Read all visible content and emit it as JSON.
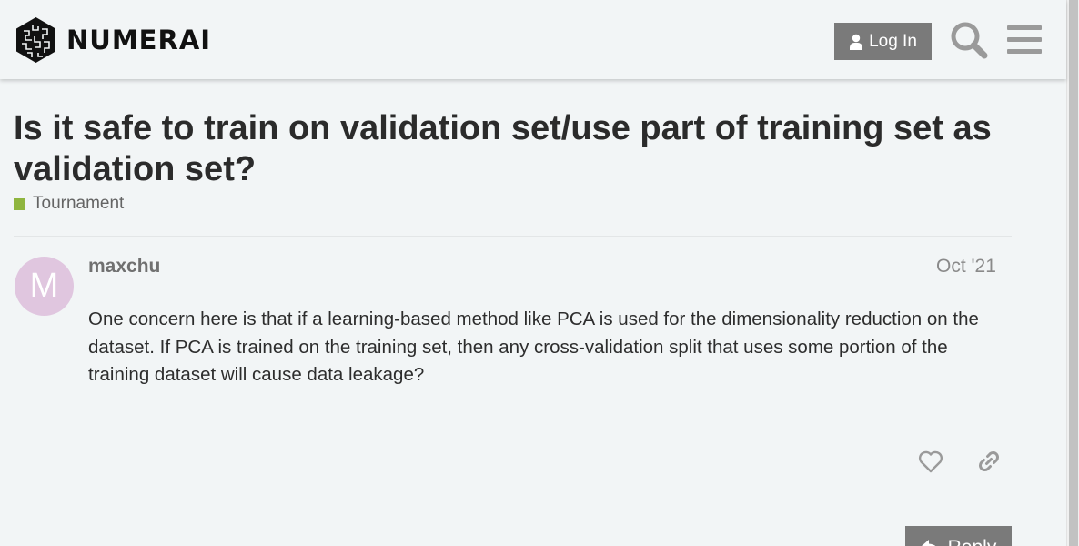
{
  "header": {
    "brand": "NUMERAI",
    "login_label": "Log In"
  },
  "topic": {
    "title": "Is it safe to train on validation set/use part of training set as validation set?",
    "category": "Tournament",
    "category_color": "#8fb53f"
  },
  "post": {
    "avatar_letter": "M",
    "avatar_color": "#e0c6df",
    "username": "maxchu",
    "date": "Oct '21",
    "body": "One concern here is that if a learning-based method like PCA is used for the dimensionality reduction on the dataset. If PCA is trained on the training set, then any cross-validation split that uses some portion of the training dataset will cause data leakage?"
  },
  "actions": {
    "reply_label": "Reply"
  },
  "icons": {
    "user": "user-icon",
    "search": "search-icon",
    "menu": "hamburger-menu-icon",
    "like": "heart-icon",
    "link": "link-icon",
    "reply": "reply-arrow-icon"
  }
}
